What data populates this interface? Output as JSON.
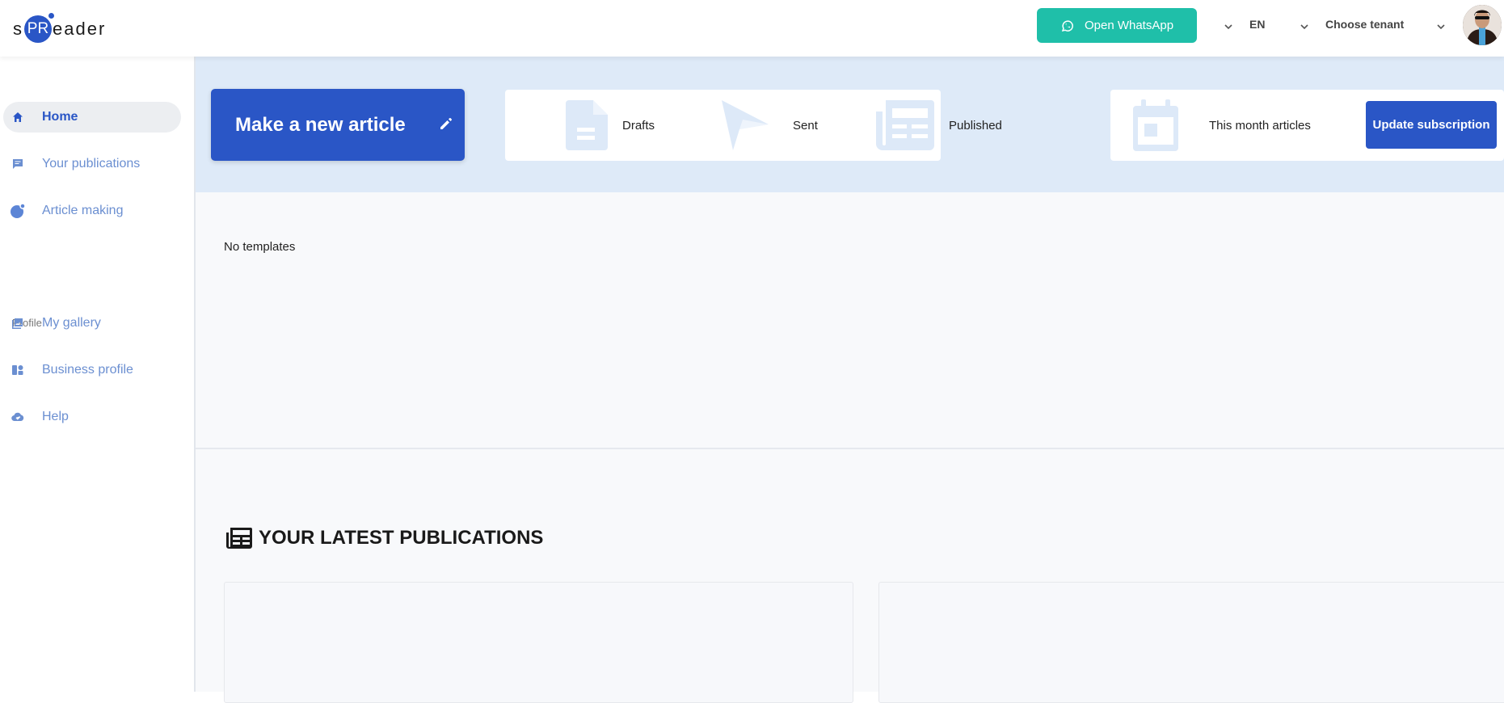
{
  "header": {
    "logo_prefix": "s",
    "logo_badge": "PR",
    "logo_suffix": "eader",
    "whatsapp_label": "Open WhatsApp",
    "language": "EN",
    "tenant_placeholder": "Choose tenant"
  },
  "sidebar": {
    "items": [
      {
        "label": "Home",
        "icon": "home-icon"
      },
      {
        "label": "Your publications",
        "icon": "chat-icon"
      },
      {
        "label": "Article making",
        "icon": "dot-icon"
      },
      {
        "label": "My gallery",
        "icon": "gallery-icon"
      },
      {
        "label": "Business profile",
        "icon": "business-icon"
      },
      {
        "label": "Help",
        "icon": "cloud-check-icon"
      }
    ],
    "section_profile": "Profile"
  },
  "main": {
    "new_article_label": "Make a new article",
    "stats": {
      "drafts": "Drafts",
      "sent": "Sent",
      "published": "Published",
      "this_month": "This month articles"
    },
    "update_subscription": "Update subscription",
    "no_templates": "No templates",
    "latest_title": "YOUR LATEST PUBLICATIONS"
  },
  "colors": {
    "primary": "#2a56c6",
    "whatsapp": "#1fbfa9",
    "band": "#deeaf8",
    "nav_text": "#6b8fd1"
  }
}
